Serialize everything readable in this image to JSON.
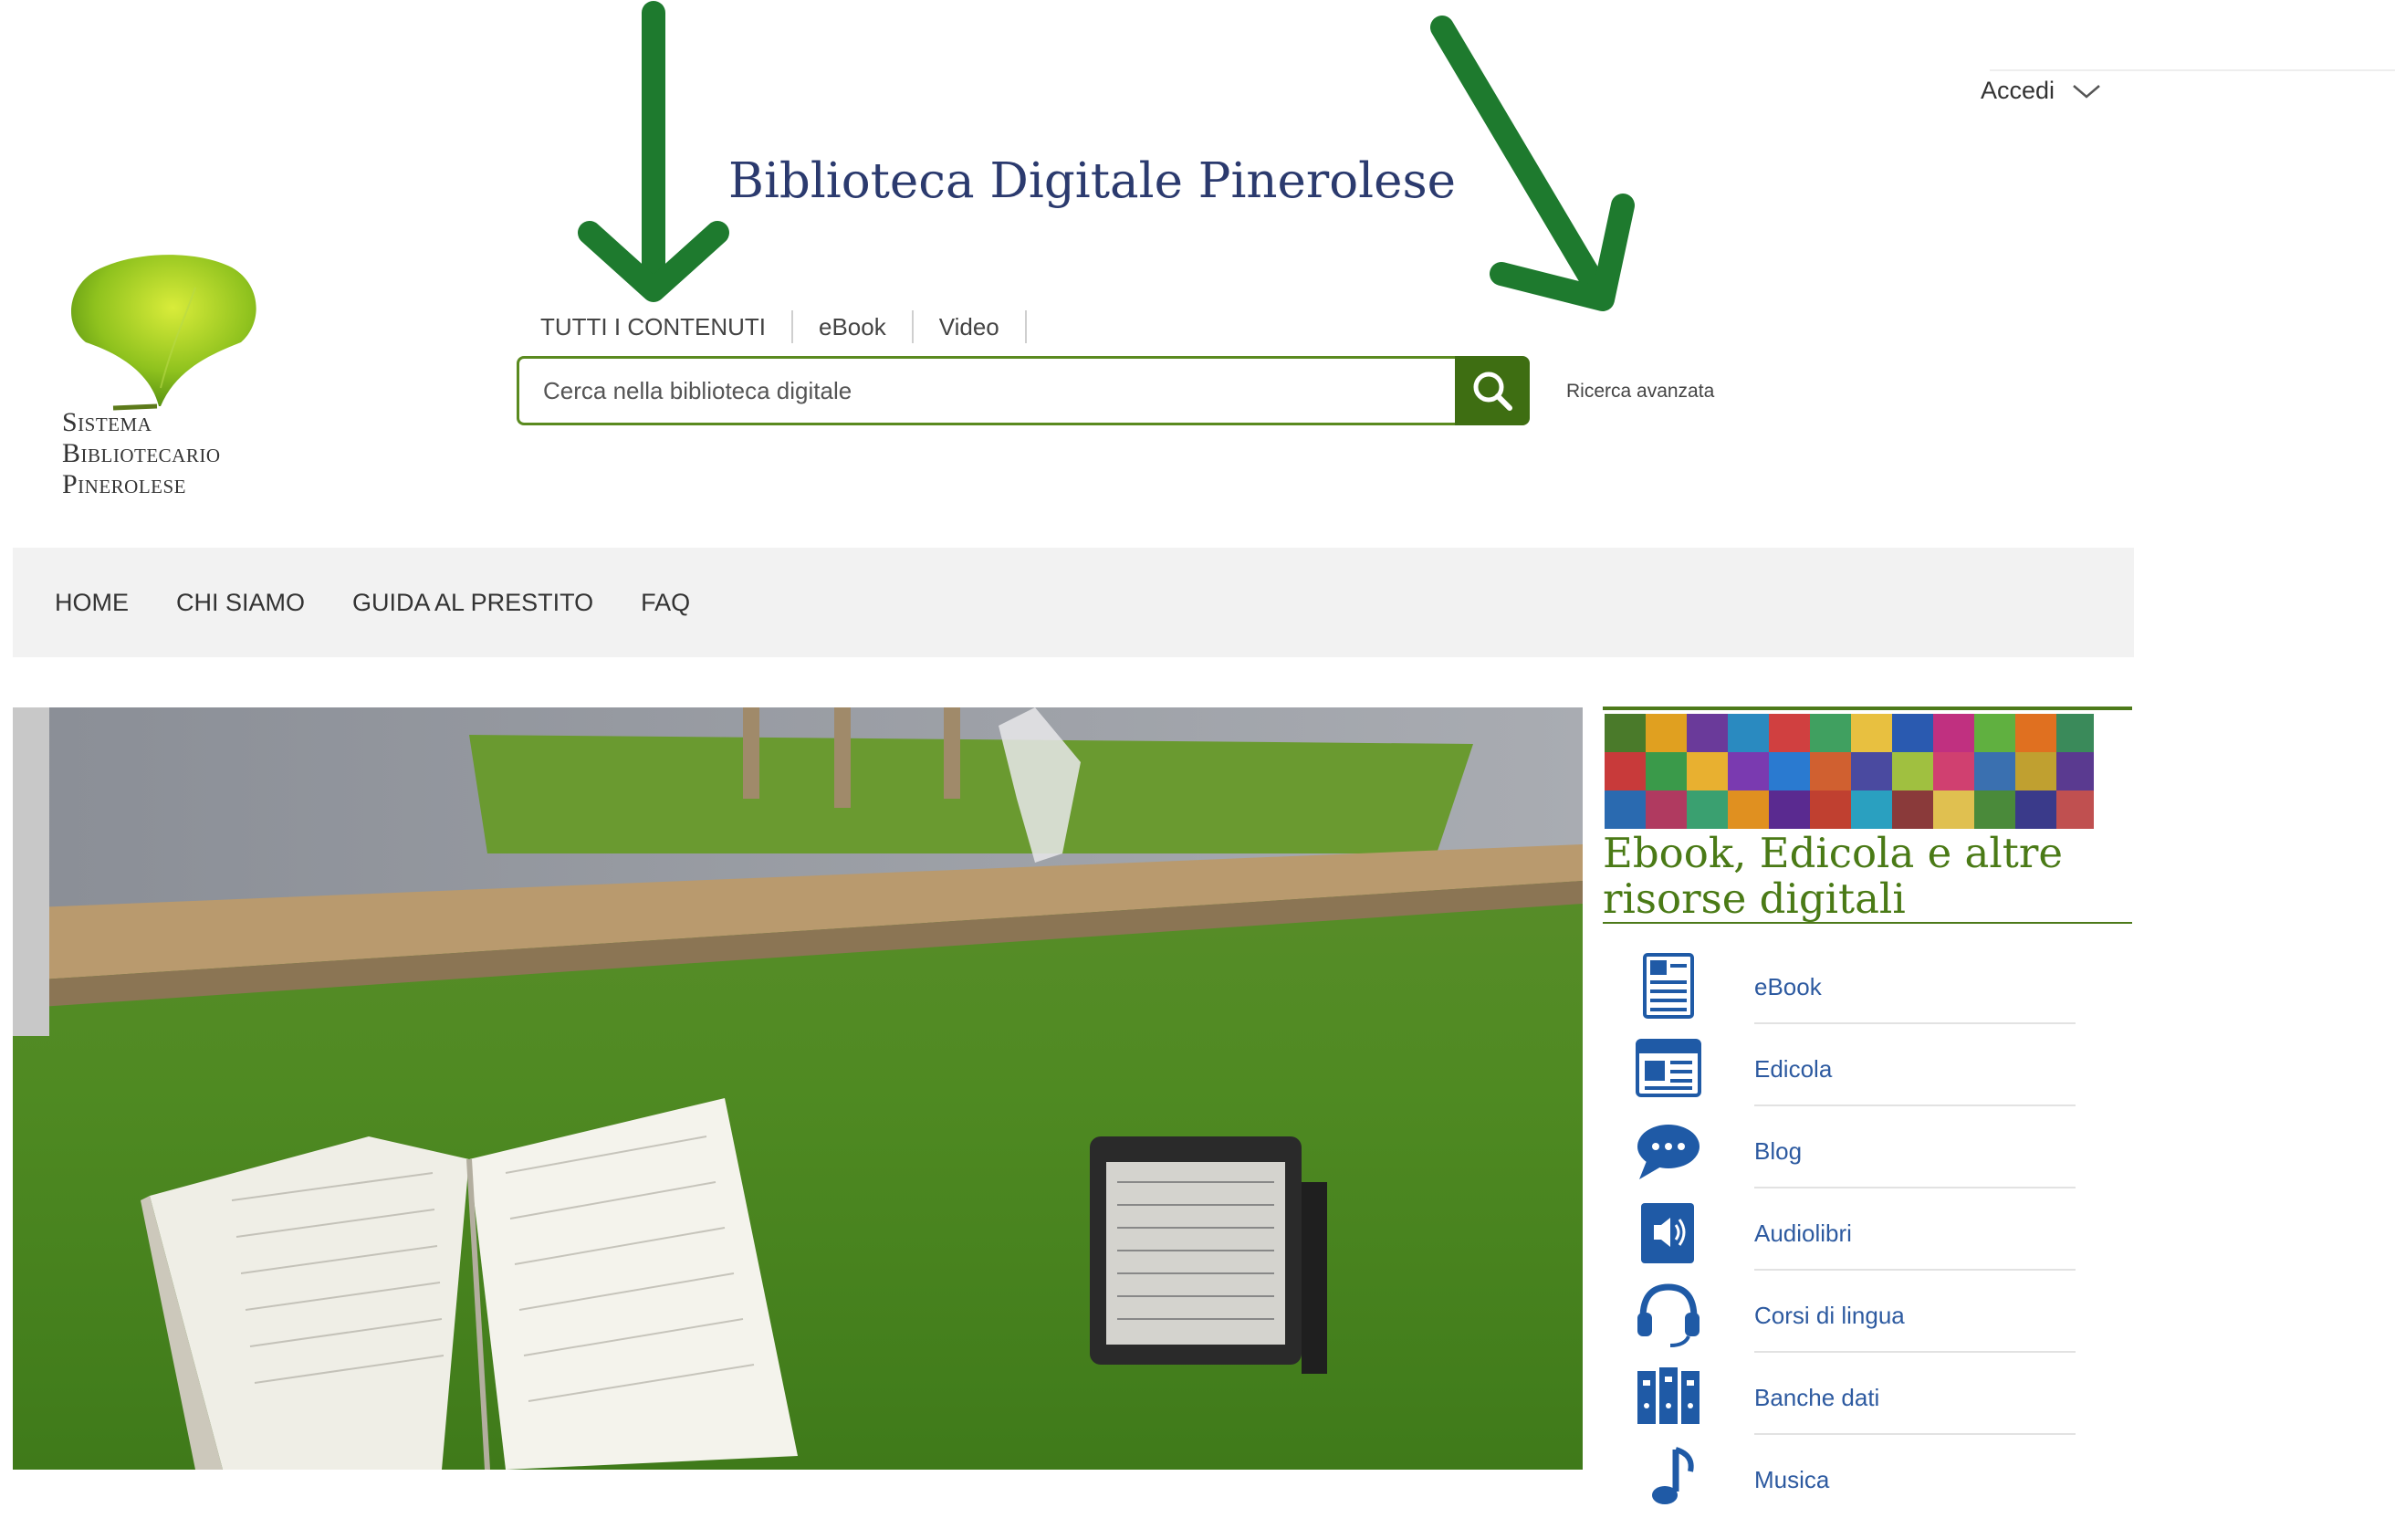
{
  "header": {
    "login_label": "Accedi",
    "site_title": "Biblioteca Digitale Pinerolese"
  },
  "logo": {
    "lines": [
      "Sistema",
      "Bibliotecario",
      "Pinerolese"
    ]
  },
  "search": {
    "tabs": [
      "TUTTI I CONTENUTI",
      "eBook",
      "Video"
    ],
    "placeholder": "Cerca nella biblioteca digitale",
    "advanced_label": "Ricerca avanzata"
  },
  "nav": {
    "items": [
      "HOME",
      "CHI SIAMO",
      "GUIDA AL PRESTITO",
      "FAQ"
    ]
  },
  "panel": {
    "title": "Ebook, Edicola e altre risorse digitali",
    "items": [
      {
        "label": "eBook",
        "icon": "ebook-icon"
      },
      {
        "label": "Edicola",
        "icon": "newspaper-icon"
      },
      {
        "label": "Blog",
        "icon": "chat-bubble-icon"
      },
      {
        "label": "Audiolibri",
        "icon": "audio-book-icon"
      },
      {
        "label": "Corsi di lingua",
        "icon": "headset-icon"
      },
      {
        "label": "Banche dati",
        "icon": "binders-icon"
      },
      {
        "label": "Musica",
        "icon": "music-note-icon"
      }
    ]
  },
  "colors": {
    "accent_green": "#3e6e12",
    "title_blue": "#2b3a6e",
    "link_blue": "#2d5aa0",
    "arrow_green": "#1e7a2e"
  }
}
